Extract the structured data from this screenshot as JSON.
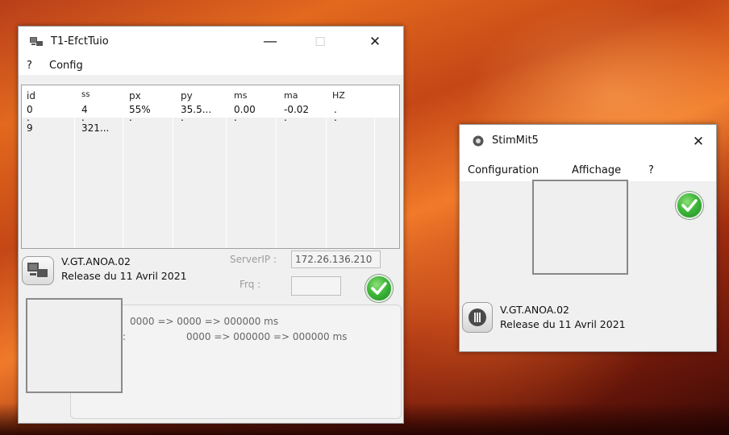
{
  "window1": {
    "title": "T1-EfctTuio",
    "titlebar_icons": {
      "minimize": "—",
      "maximize": "☐",
      "close": "✕"
    },
    "menu": [
      "?",
      "Config"
    ],
    "table": {
      "headers": [
        "id",
        "ss",
        "px",
        "py",
        "ms",
        "ma",
        "HZ"
      ],
      "rows": [
        [
          "0",
          "4",
          "55%",
          "35.5...",
          "0.00",
          "-0.02",
          "."
        ],
        [
          ".",
          ".",
          ".",
          ".",
          ".",
          ".",
          "."
        ],
        [
          "9",
          "321...",
          "",
          "",
          "",
          "",
          ""
        ]
      ]
    },
    "version": "V.GT.ANOA.02",
    "release": "Release du 11 Avril 2021",
    "server_label": "ServerIP :",
    "server_value": "172.26.136.210",
    "frq_label": "Frq :",
    "frq_value": "",
    "timing_line1": "0000 => 0000 => 000000 ms",
    "timing_line2_prefix": ":",
    "timing_line2": "0000 => 000000 => 000000 ms",
    "icon": "computer-network-icon",
    "status_icon": "green-check-icon"
  },
  "window2": {
    "title": "StimMit5",
    "titlebar_icons": {
      "close": "✕"
    },
    "menu": [
      "Configuration",
      "Affichage",
      "?"
    ],
    "version": "V.GT.ANOA.02",
    "release": "Release du 11 Avril 2021",
    "icon": "stim-record-icon",
    "status_icon": "green-check-icon"
  },
  "colors": {
    "check_green": "#3fb83a",
    "window_bg": "#f0f0f0",
    "desktop_orange": "#e2691e"
  }
}
